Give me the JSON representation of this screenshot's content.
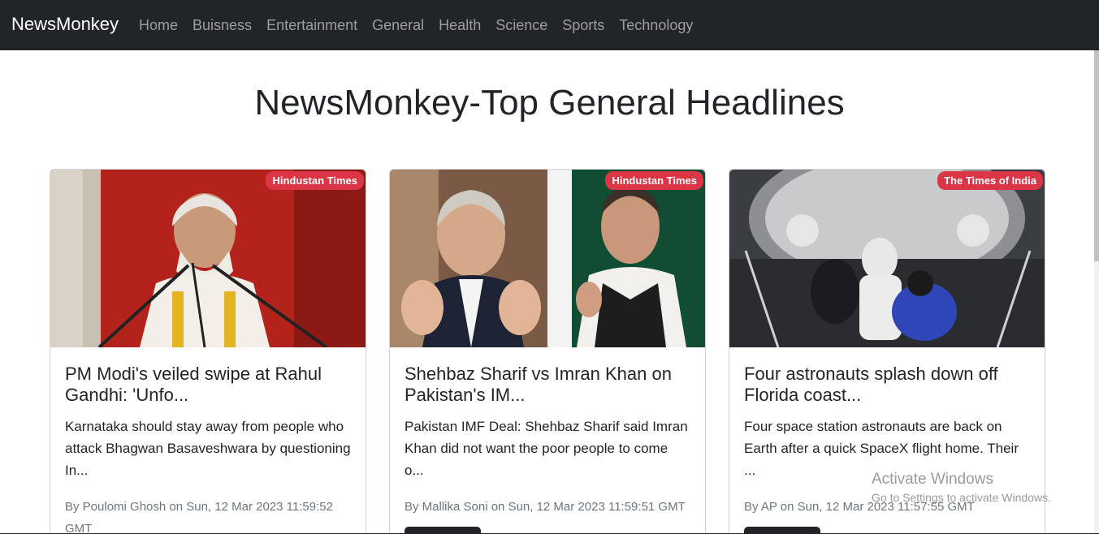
{
  "navbar": {
    "brand": "NewsMonkey",
    "links": [
      "Home",
      "Buisness",
      "Entertainment",
      "General",
      "Health",
      "Science",
      "Sports",
      "Technology"
    ]
  },
  "page": {
    "title": "NewsMonkey-Top General Headlines"
  },
  "articles": [
    {
      "source": "Hindustan Times",
      "title": "PM Modi's veiled swipe at Rahul Gandhi: 'Unfo...",
      "description": "Karnataka should stay away from people who attack Bhagwan Basaveshwara by questioning In...",
      "meta": "By Poulomi Ghosh on Sun, 12 Mar 2023 11:59:52 GMT"
    },
    {
      "source": "Hindustan Times",
      "title": "Shehbaz Sharif vs Imran Khan on Pakistan's IM...",
      "description": "Pakistan IMF Deal: Shehbaz Sharif said Imran Khan did not want the poor people to come o...",
      "meta": "By Mallika Soni on Sun, 12 Mar 2023 11:59:51 GMT"
    },
    {
      "source": "The Times of India",
      "title": "Four astronauts splash down off Florida coast...",
      "description": "Four space station astronauts are back on Earth after a quick SpaceX flight home. Their ...",
      "meta": "By AP on Sun, 12 Mar 2023 11:57:55 GMT"
    }
  ],
  "watermark": {
    "title": "Activate Windows",
    "subtitle": "Go to Settings to activate Windows."
  },
  "colors": {
    "navbar_bg": "#212529",
    "badge_bg": "#dc3545",
    "button_bg": "#212529"
  }
}
